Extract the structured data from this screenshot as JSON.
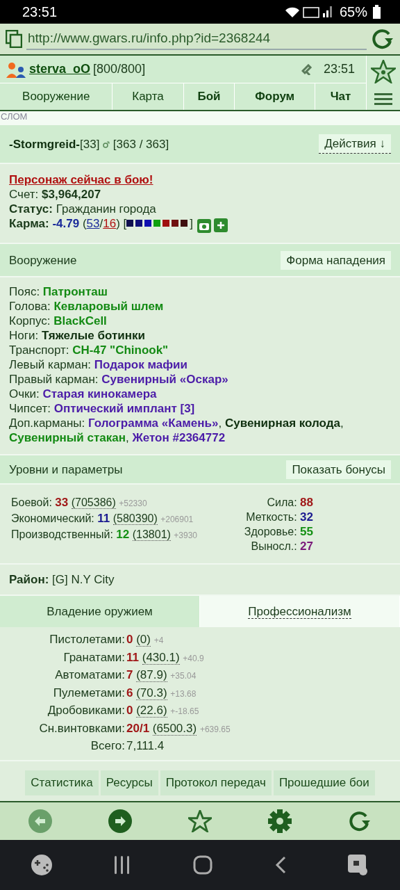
{
  "status_bar": {
    "time": "23:51",
    "battery": "65%"
  },
  "browser": {
    "url": "http://www.gwars.ru/info.php?id=2368244"
  },
  "header": {
    "user": "sterva_oO",
    "hp": "[800/800]",
    "time": "23:51"
  },
  "nav": [
    {
      "label": "Вооружение",
      "bold": false
    },
    {
      "label": "Карта",
      "bold": false
    },
    {
      "label": "Бой",
      "bold": true
    },
    {
      "label": "Форум",
      "bold": true
    },
    {
      "label": "Чат",
      "bold": true
    }
  ],
  "crumb": "СЛОМ",
  "character": {
    "name": "-Stormgreid-",
    "level": "[33]",
    "hp": "[363 / 363]",
    "actions": "Действия ↓"
  },
  "info": {
    "alert": "Персонаж сейчас в бою!",
    "account_label": "Счет:",
    "account": "$3,964,207",
    "status_label": "Статус:",
    "status": "Гражданин города",
    "karma_label": "Карма:",
    "karma": "-4.79",
    "karma_plus": "53",
    "karma_minus": "16",
    "paren_open": "(",
    "slash": "/",
    "paren_close": ")",
    "bracket_open": "[",
    "bracket_close": "]",
    "karma_marks": [
      {
        "color": "#101050"
      },
      {
        "color": "#10107a"
      },
      {
        "color": "#1010b0"
      },
      {
        "color": "#10a010"
      },
      {
        "color": "#a01010"
      },
      {
        "color": "#701010"
      },
      {
        "color": "#401010"
      }
    ]
  },
  "equipment": {
    "title": "Вооружение",
    "button": "Форма нападения",
    "items": [
      {
        "label": "Пояс:",
        "values": [
          {
            "text": "Патронташ",
            "color": "#138a13"
          }
        ]
      },
      {
        "label": "Голова:",
        "values": [
          {
            "text": "Кевларовый шлем",
            "color": "#138a13"
          }
        ]
      },
      {
        "label": "Корпус:",
        "values": [
          {
            "text": "BlackCell",
            "color": "#138a13"
          }
        ]
      },
      {
        "label": "Ноги:",
        "values": [
          {
            "text": "Тяжелые ботинки",
            "color": "#0f2f0f"
          }
        ]
      },
      {
        "label": "Транспорт:",
        "values": [
          {
            "text": "CH-47 \"Chinook\"",
            "color": "#138a13"
          }
        ]
      },
      {
        "label": "Левый карман:",
        "values": [
          {
            "text": "Подарок мафии",
            "color": "#4b1ca8"
          }
        ]
      },
      {
        "label": "Правый карман:",
        "values": [
          {
            "text": "Сувенирный «Оскар»",
            "color": "#4b1ca8"
          }
        ]
      },
      {
        "label": "Очки:",
        "values": [
          {
            "text": "Старая кинокамера",
            "color": "#4b1ca8"
          }
        ]
      },
      {
        "label": "Чипсет:",
        "values": [
          {
            "text": "Оптический имплант [3]",
            "color": "#4b1ca8"
          }
        ]
      },
      {
        "label": "Доп.карманы:",
        "separator": ",",
        "values": [
          {
            "text": "Голограмма «Камень»",
            "color": "#4b1ca8"
          },
          {
            "text": "Сувенирная колода",
            "color": "#0f2f0f"
          },
          {
            "text": "Сувенирный стакан",
            "color": "#138a13"
          },
          {
            "text": "Жетон #2364772",
            "color": "#4b1ca8"
          }
        ]
      }
    ]
  },
  "levels": {
    "title": "Уровни и параметры",
    "button": "Показать бонусы",
    "rows": [
      {
        "label": "Боевой:",
        "level": "33",
        "color": "#a01818",
        "exp": "(705386)",
        "bonus": "+52330"
      },
      {
        "label": "Экономический:",
        "level": "11",
        "color": "#1a1a90",
        "exp": "(580390)",
        "bonus": "+206901"
      },
      {
        "label": "Производственный:",
        "level": "12",
        "color": "#139013",
        "exp": "(13801)",
        "bonus": "+3930"
      }
    ],
    "stats": [
      {
        "label": "Сила:",
        "value": "88",
        "color": "#a01818"
      },
      {
        "label": "Меткость:",
        "value": "32",
        "color": "#1a1a90"
      },
      {
        "label": "Здоровье:",
        "value": "55",
        "color": "#139013"
      },
      {
        "label": "Выносл.:",
        "value": "27",
        "color": "#7a1a7a"
      }
    ]
  },
  "district": {
    "label": "Район:",
    "value": "[G] N.Y City"
  },
  "skill_tabs": [
    {
      "label": "Владение оружием",
      "selected": true
    },
    {
      "label": "Профессионализм",
      "selected": false
    }
  ],
  "skills": [
    {
      "label": "Пистолетами:",
      "level": "0",
      "value": "(0)",
      "bonus": "+4"
    },
    {
      "label": "Гранатами:",
      "level": "11",
      "value": "(430.1)",
      "bonus": "+40.9"
    },
    {
      "label": "Автоматами:",
      "level": "7",
      "value": "(87.9)",
      "bonus": "+35.04"
    },
    {
      "label": "Пулеметами:",
      "level": "6",
      "value": "(70.3)",
      "bonus": "+13.68"
    },
    {
      "label": "Дробовиками:",
      "level": "0",
      "value": "(22.6)",
      "bonus": "+-18.65"
    },
    {
      "label": "Сн.винтовками:",
      "level": "20/1",
      "value": "(6500.3)",
      "bonus": "+639.65"
    }
  ],
  "total": {
    "label": "Всего:",
    "value": "7,111.4"
  },
  "bottom_tabs": [
    "Статистика",
    "Ресурсы",
    "Протокол передач",
    "Прошедшие бои"
  ]
}
